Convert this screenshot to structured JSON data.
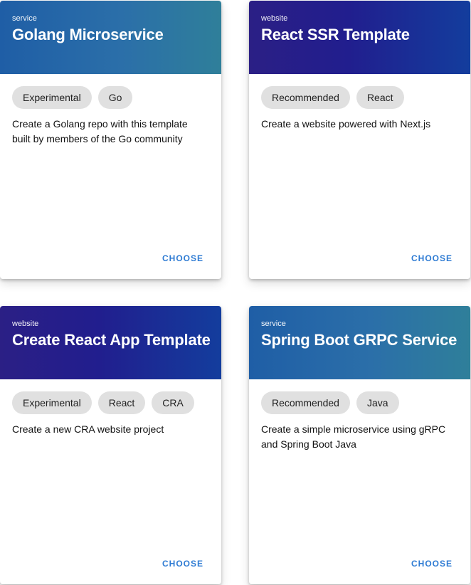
{
  "cards": [
    {
      "type": "service",
      "title": "Golang Microservice",
      "tags": [
        "Experimental",
        "Go"
      ],
      "description": "Create a Golang repo with this template built by members of the Go community",
      "action": "CHOOSE"
    },
    {
      "type": "website",
      "title": "React SSR Template",
      "tags": [
        "Recommended",
        "React"
      ],
      "description": "Create a website powered with Next.js",
      "action": "CHOOSE"
    },
    {
      "type": "website",
      "title": "Create React App Template",
      "tags": [
        "Experimental",
        "React",
        "CRA"
      ],
      "description": "Create a new CRA website project",
      "action": "CHOOSE"
    },
    {
      "type": "service",
      "title": "Spring Boot GRPC Service",
      "tags": [
        "Recommended",
        "Java"
      ],
      "description": "Create a simple microservice using gRPC and Spring Boot Java",
      "action": "CHOOSE"
    }
  ],
  "colors": {
    "service_header": "#2b6fa9",
    "website_header": "#211e8e",
    "action": "#2e7bd3",
    "chip_bg": "#e0e0e0"
  }
}
